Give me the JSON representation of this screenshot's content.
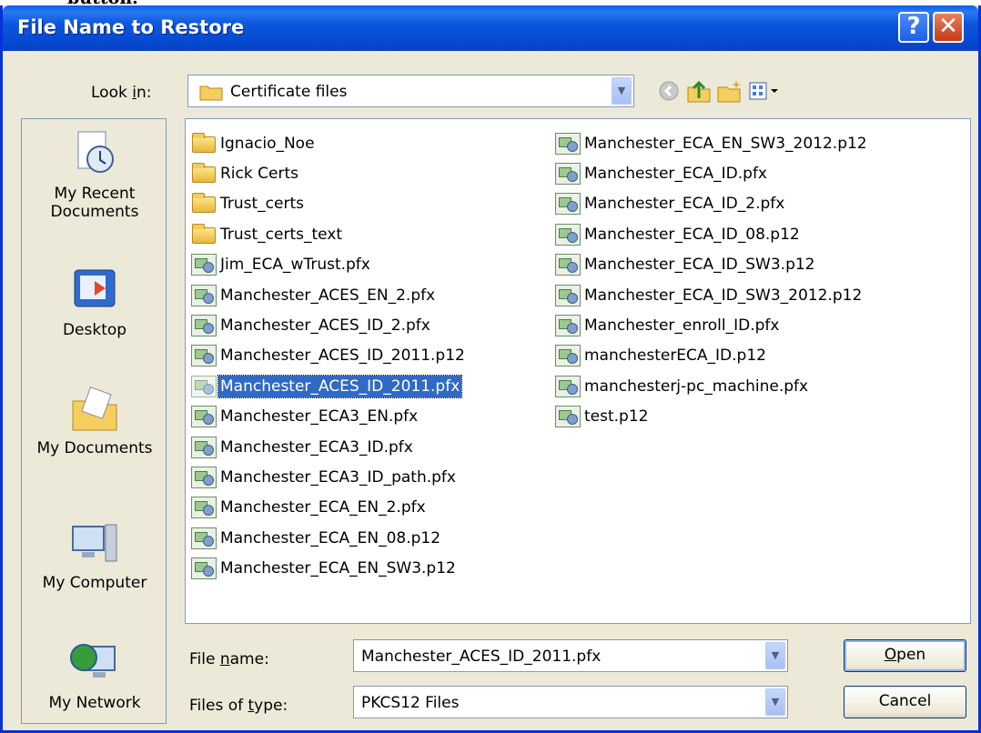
{
  "background_caption": "button.",
  "window": {
    "title": "File Name to Restore",
    "help_label": "?",
    "close_label": "✕"
  },
  "lookin": {
    "label": "Look in:",
    "value": "Certificate files"
  },
  "toolbar": {
    "back": "back-icon",
    "up": "up-folder-icon",
    "newfolder": "new-folder-icon",
    "views": "views-menu-icon"
  },
  "places": [
    {
      "label": "My Recent Documents",
      "icon": "recent-documents-icon"
    },
    {
      "label": "Desktop",
      "icon": "desktop-icon"
    },
    {
      "label": "My Documents",
      "icon": "my-documents-icon"
    },
    {
      "label": "My Computer",
      "icon": "my-computer-icon"
    },
    {
      "label": "My Network",
      "icon": "my-network-icon"
    }
  ],
  "files_col1": [
    {
      "name": "Ignacio_Noe",
      "type": "folder"
    },
    {
      "name": "Rick Certs",
      "type": "folder"
    },
    {
      "name": "Trust_certs",
      "type": "folder"
    },
    {
      "name": "Trust_certs_text",
      "type": "folder"
    },
    {
      "name": "Jim_ECA_wTrust.pfx",
      "type": "cert"
    },
    {
      "name": "Manchester_ACES_EN_2.pfx",
      "type": "cert"
    },
    {
      "name": "Manchester_ACES_ID_2.pfx",
      "type": "cert"
    },
    {
      "name": "Manchester_ACES_ID_2011.p12",
      "type": "cert"
    },
    {
      "name": "Manchester_ACES_ID_2011.pfx",
      "type": "cert",
      "selected": true
    },
    {
      "name": "Manchester_ECA3_EN.pfx",
      "type": "cert"
    },
    {
      "name": "Manchester_ECA3_ID.pfx",
      "type": "cert"
    },
    {
      "name": "Manchester_ECA3_ID_path.pfx",
      "type": "cert"
    },
    {
      "name": "Manchester_ECA_EN_2.pfx",
      "type": "cert"
    },
    {
      "name": "Manchester_ECA_EN_08.p12",
      "type": "cert"
    },
    {
      "name": "Manchester_ECA_EN_SW3.p12",
      "type": "cert"
    }
  ],
  "files_col2": [
    {
      "name": "Manchester_ECA_EN_SW3_2012.p12",
      "type": "cert"
    },
    {
      "name": "Manchester_ECA_ID.pfx",
      "type": "cert"
    },
    {
      "name": "Manchester_ECA_ID_2.pfx",
      "type": "cert"
    },
    {
      "name": "Manchester_ECA_ID_08.p12",
      "type": "cert"
    },
    {
      "name": "Manchester_ECA_ID_SW3.p12",
      "type": "cert"
    },
    {
      "name": "Manchester_ECA_ID_SW3_2012.p12",
      "type": "cert"
    },
    {
      "name": "Manchester_enroll_ID.pfx",
      "type": "cert"
    },
    {
      "name": "manchesterECA_ID.p12",
      "type": "cert"
    },
    {
      "name": "manchesterj-pc_machine.pfx",
      "type": "cert"
    },
    {
      "name": "test.p12",
      "type": "cert"
    }
  ],
  "filename": {
    "label_pre": "File ",
    "label_key": "n",
    "label_post": "ame:",
    "value": "Manchester_ACES_ID_2011.pfx"
  },
  "filetype": {
    "label_pre": "Files of ",
    "label_key": "t",
    "label_post": "ype:",
    "value": "PKCS12 Files"
  },
  "buttons": {
    "open_key": "O",
    "open_rest": "pen",
    "cancel": "Cancel"
  }
}
